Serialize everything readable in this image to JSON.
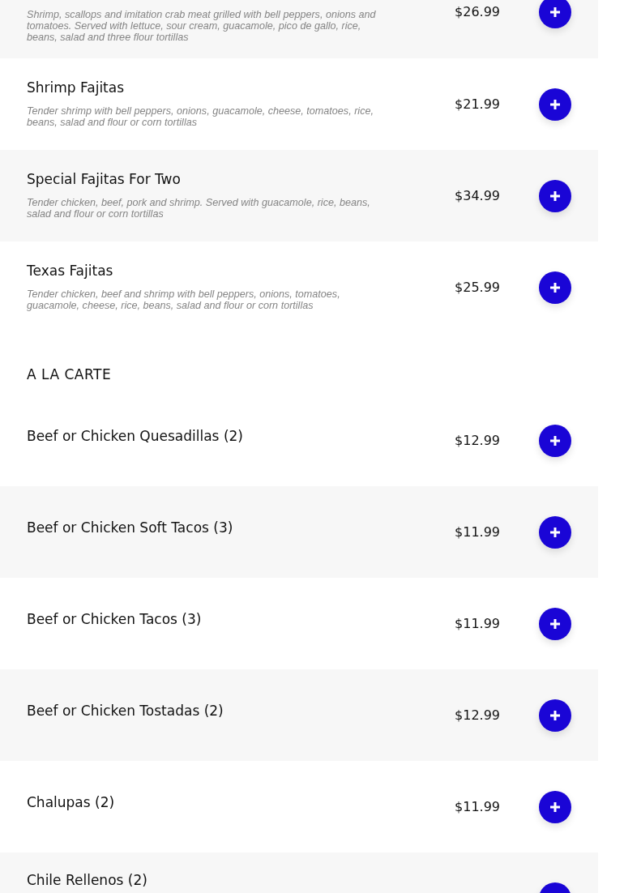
{
  "sections": [
    {
      "items": [
        {
          "description": "Shrimp, scallops and imitation crab meat grilled with bell peppers, onions and tomatoes. Served with lettuce, sour cream, guacamole, pico de gallo, rice, beans, salad and three flour tortillas",
          "price": "$26.99"
        },
        {
          "name": "Shrimp Fajitas",
          "description": "Tender shrimp with bell peppers, onions, guacamole, cheese, tomatoes, rice, beans, salad and flour or corn tortillas",
          "price": "$21.99"
        },
        {
          "name": "Special Fajitas For Two",
          "description": "Tender chicken, beef, pork and shrimp. Served with guacamole, rice, beans, salad and flour or corn tortillas",
          "price": "$34.99"
        },
        {
          "name": "Texas Fajitas",
          "description": "Tender chicken, beef and shrimp with bell peppers, onions, tomatoes, guacamole, cheese, rice, beans, salad and flour or corn tortillas",
          "price": "$25.99"
        }
      ]
    },
    {
      "heading": "A LA CARTE",
      "items": [
        {
          "name": "Beef or Chicken Quesadillas (2)",
          "price": "$12.99"
        },
        {
          "name": "Beef or Chicken Soft Tacos (3)",
          "price": "$11.99"
        },
        {
          "name": "Beef or Chicken Tacos (3)",
          "price": "$11.99"
        },
        {
          "name": "Beef or Chicken Tostadas (2)",
          "price": "$12.99"
        },
        {
          "name": "Chalupas (2)",
          "price": "$11.99"
        },
        {
          "name": "Chile Rellenos (2)"
        }
      ]
    }
  ]
}
